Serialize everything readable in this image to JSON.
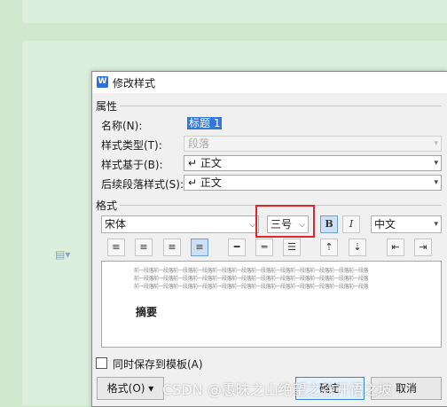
{
  "dialog": {
    "title": "修改样式",
    "app_icon_letter": "W",
    "properties": {
      "section_label": "属性",
      "name_label": "名称(N):",
      "name_value": "标题 1",
      "style_type_label": "样式类型(T):",
      "style_type_value": "段落",
      "based_on_label": "样式基于(B):",
      "based_on_value": "↵ 正文",
      "next_style_label": "后续段落样式(S):",
      "next_style_value": "↵ 正文"
    },
    "format": {
      "section_label": "格式",
      "font_value": "宋体",
      "size_value": "三号",
      "bold_label": "B",
      "italic_label": "I",
      "language_value": "中文"
    },
    "preview": {
      "prev_paragraph_text": "前一段落前一段落前一段落前一段落前一段落前一段落前一段落前一段落前一段落前一段落前一段落前一段落",
      "sample_text": "摘要"
    },
    "checkbox_label": "同时保存到模板(A)",
    "buttons": {
      "format": "格式(O)",
      "ok": "确定",
      "cancel": "取消"
    }
  },
  "watermark": "CSDN @愚昧之山绝望之谷开悟之坡"
}
